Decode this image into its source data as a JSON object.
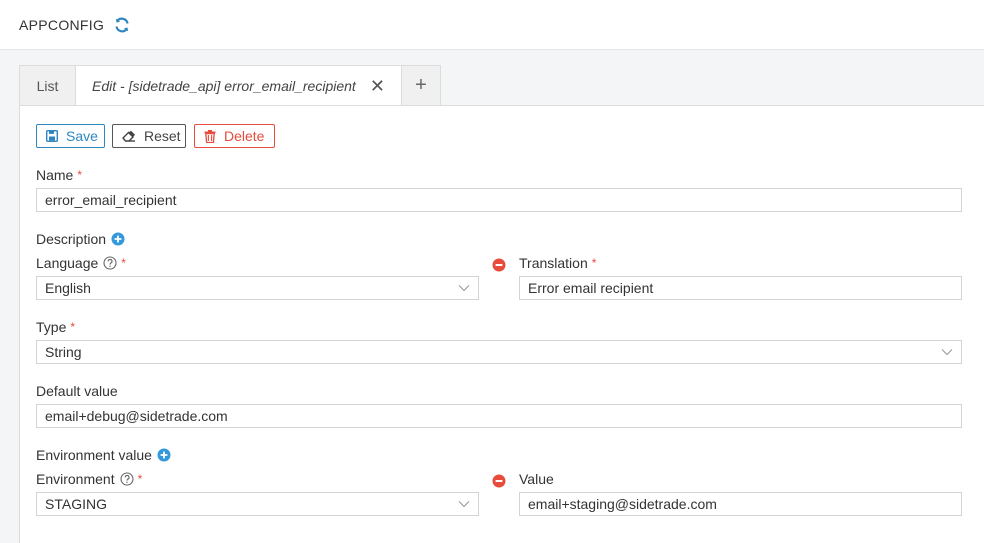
{
  "header": {
    "title": "APPCONFIG",
    "refresh_icon": "refresh-icon"
  },
  "tabs": {
    "list_label": "List",
    "edit_label": "Edit - [sidetrade_api] error_email_recipient",
    "close_glyph": "✕",
    "add_glyph": "+"
  },
  "toolbar": {
    "save_label": "Save",
    "reset_label": "Reset",
    "delete_label": "Delete"
  },
  "form": {
    "name": {
      "label": "Name",
      "required": "*",
      "value": "error_email_recipient"
    },
    "description": {
      "label": "Description",
      "language": {
        "label": "Language",
        "required": "*",
        "value": "English"
      },
      "translation": {
        "label": "Translation",
        "required": "*",
        "value": "Error email recipient"
      }
    },
    "type": {
      "label": "Type",
      "required": "*",
      "value": "String"
    },
    "default_value": {
      "label": "Default value",
      "value": "email+debug@sidetrade.com"
    },
    "environment_value": {
      "label": "Environment value",
      "environment": {
        "label": "Environment",
        "required": "*",
        "value": "STAGING"
      },
      "value": {
        "label": "Value",
        "value": "email+staging@sidetrade.com"
      }
    }
  },
  "colors": {
    "primary": "#2e86c1",
    "danger": "#e74c3c",
    "add_blue": "#3498db"
  }
}
